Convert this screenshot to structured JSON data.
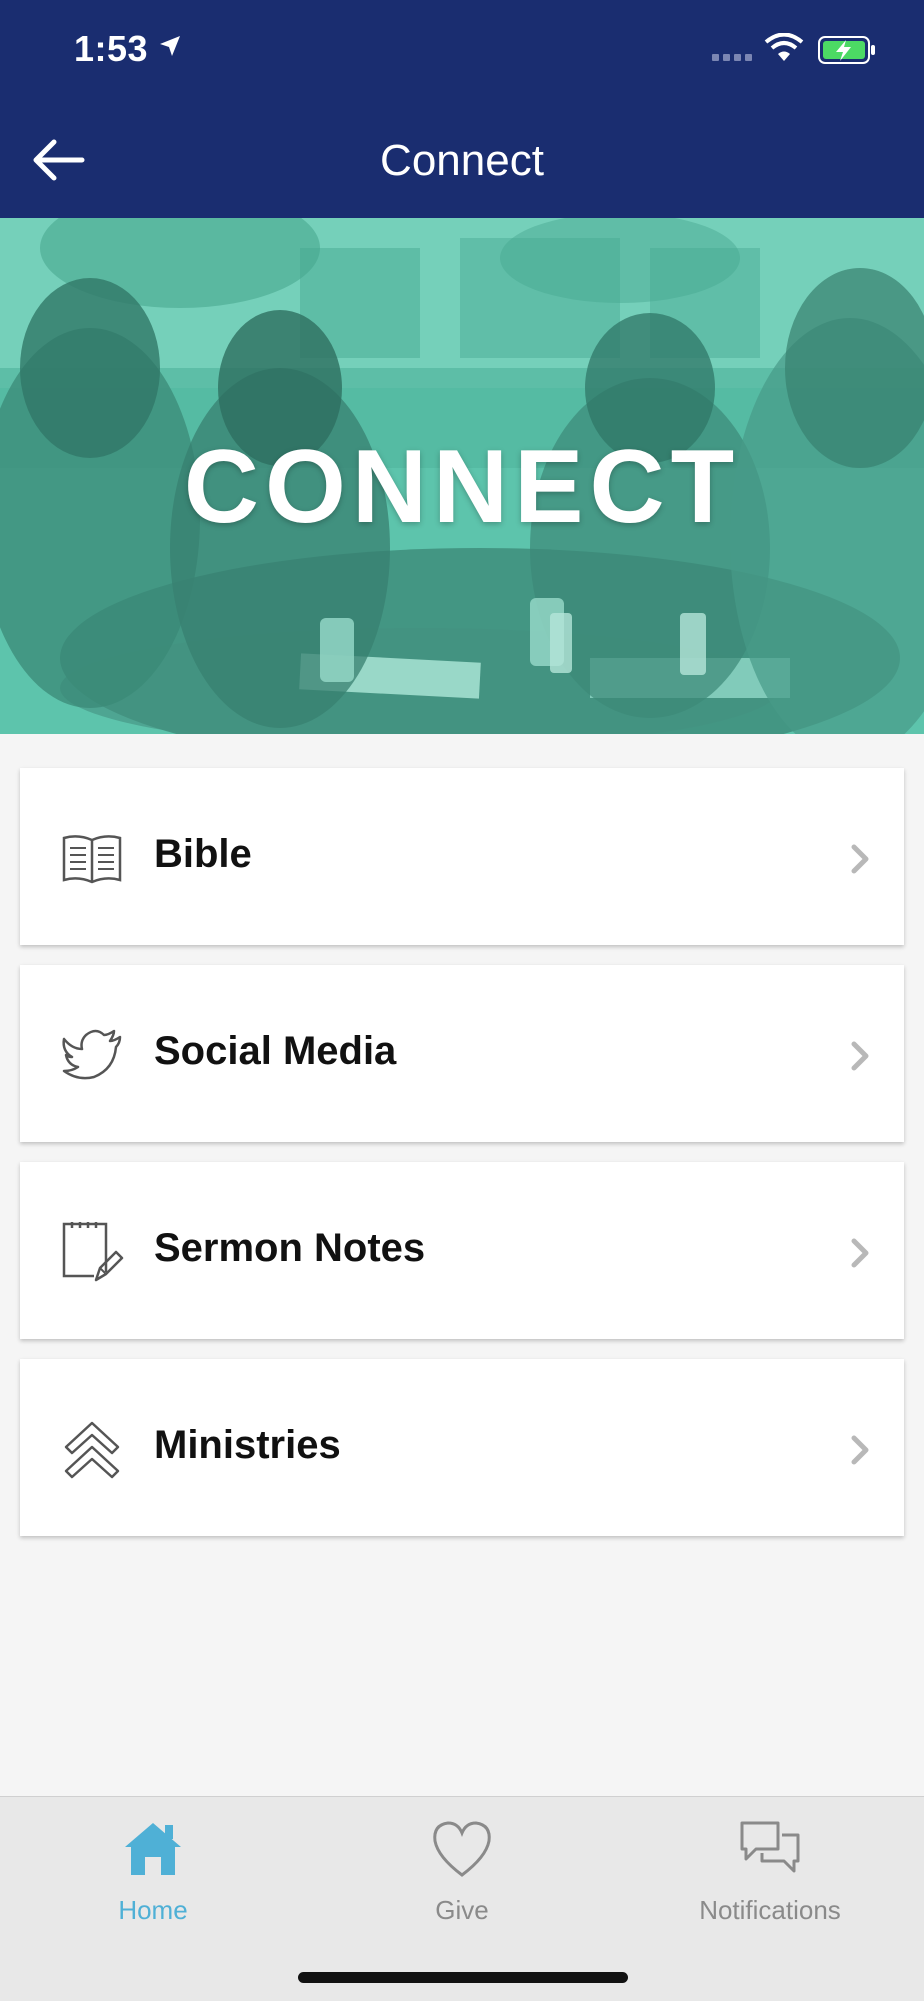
{
  "status_bar": {
    "time": "1:53",
    "icons": [
      "location-arrow-icon",
      "signal-icon",
      "wifi-icon",
      "battery-charging-icon"
    ]
  },
  "nav": {
    "title": "Connect",
    "back_icon": "arrow-left-icon"
  },
  "hero": {
    "text": "CONNECT",
    "overlay_color": "#5ec4ac"
  },
  "menu": {
    "items": [
      {
        "label": "Bible",
        "icon": "open-book-icon"
      },
      {
        "label": "Social Media",
        "icon": "bird-icon"
      },
      {
        "label": "Sermon Notes",
        "icon": "notepad-pencil-icon"
      },
      {
        "label": "Ministries",
        "icon": "double-chevron-up-icon"
      }
    ]
  },
  "tabbar": {
    "tabs": [
      {
        "label": "Home",
        "icon": "home-icon",
        "active": true
      },
      {
        "label": "Give",
        "icon": "heart-icon",
        "active": false
      },
      {
        "label": "Notifications",
        "icon": "chat-bubbles-icon",
        "active": false
      }
    ]
  },
  "colors": {
    "header": "#1a2d70",
    "accent": "#4fb0d6",
    "hero_teal": "#5ec4ac",
    "background": "#f5f5f5"
  }
}
